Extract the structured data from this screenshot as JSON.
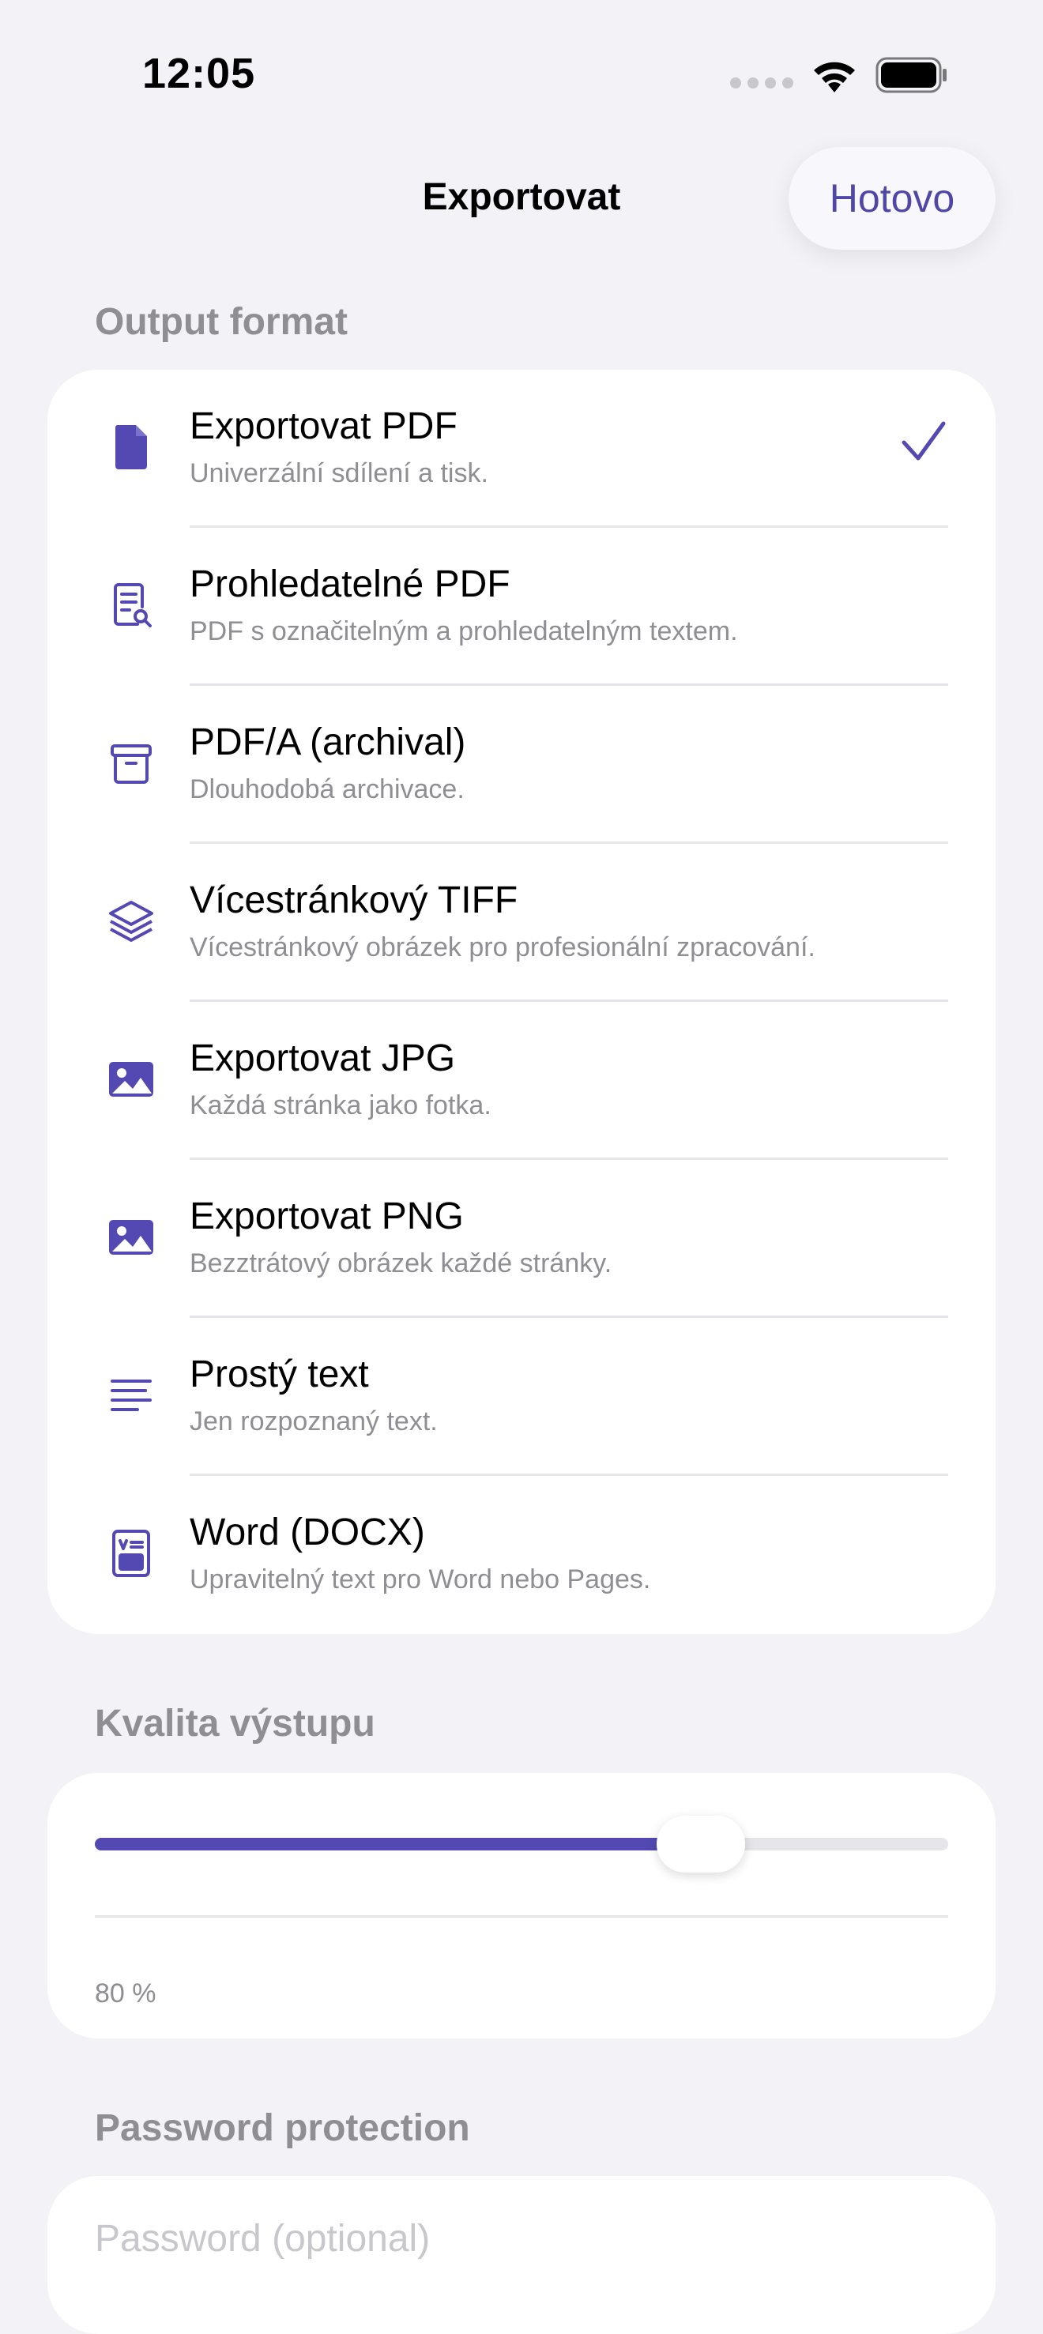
{
  "status_bar": {
    "time": "12:05"
  },
  "nav": {
    "title": "Exportovat",
    "done_label": "Hotovo"
  },
  "sections": {
    "output_format": "Output format",
    "quality": "Kvalita výstupu",
    "password": "Password protection"
  },
  "formats": [
    {
      "title": "Exportovat PDF",
      "subtitle": "Univerzální sdílení a tisk.",
      "icon": "document-icon",
      "selected": true
    },
    {
      "title": "Prohledatelné PDF",
      "subtitle": "PDF s označitelným a prohledatelným textem.",
      "icon": "document-search-icon",
      "selected": false
    },
    {
      "title": "PDF/A (archival)",
      "subtitle": "Dlouhodobá archivace.",
      "icon": "archive-box-icon",
      "selected": false
    },
    {
      "title": "Vícestránkový TIFF",
      "subtitle": "Vícestránkový obrázek pro profesionální zpracování.",
      "icon": "layers-icon",
      "selected": false
    },
    {
      "title": "Exportovat JPG",
      "subtitle": "Každá stránka jako fotka.",
      "icon": "photo-icon",
      "selected": false
    },
    {
      "title": "Exportovat PNG",
      "subtitle": "Bezztrátový obrázek každé stránky.",
      "icon": "photo-icon",
      "selected": false
    },
    {
      "title": "Prostý text",
      "subtitle": "Jen rozpoznaný text.",
      "icon": "text-lines-icon",
      "selected": false
    },
    {
      "title": "Word (DOCX)",
      "subtitle": "Upravitelný text pro Word nebo Pages.",
      "icon": "word-document-icon",
      "selected": false
    }
  ],
  "quality": {
    "value_label": "80 %",
    "level": 0.8
  },
  "password": {
    "placeholder": "Password (optional)",
    "value": ""
  },
  "colors": {
    "accent": "#5449b2",
    "background": "#f2f2f7",
    "secondary_text": "#8e8e93"
  }
}
